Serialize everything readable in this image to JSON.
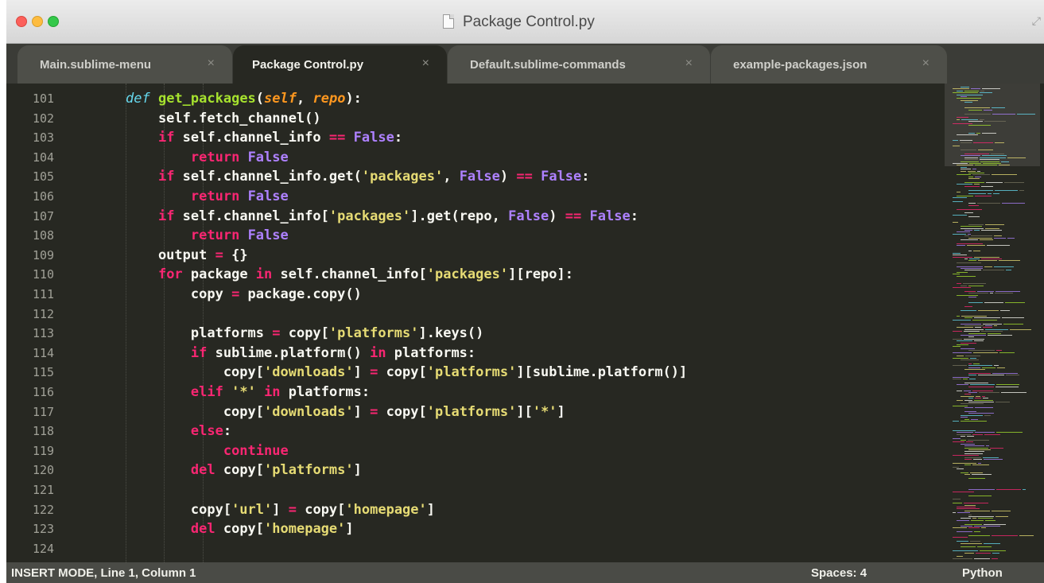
{
  "window": {
    "title": "Package Control.py"
  },
  "tabs": [
    {
      "label": "Main.sublime-menu",
      "close": "×",
      "active": false
    },
    {
      "label": "Package Control.py",
      "close": "×",
      "active": true
    },
    {
      "label": "Default.sublime-commands",
      "close": "×",
      "active": false
    },
    {
      "label": "example-packages.json",
      "close": "×",
      "active": false
    }
  ],
  "editor": {
    "line_numbers": [
      "101",
      "102",
      "103",
      "104",
      "105",
      "106",
      "107",
      "108",
      "109",
      "110",
      "111",
      "112",
      "113",
      "114",
      "115",
      "116",
      "117",
      "118",
      "119",
      "120",
      "121",
      "122",
      "123",
      "124"
    ],
    "lines": [
      "    def get_packages(self, repo):",
      "        self.fetch_channel()",
      "        if self.channel_info == False:",
      "            return False",
      "        if self.channel_info.get('packages', False) == False:",
      "            return False",
      "        if self.channel_info['packages'].get(repo, False) == False:",
      "            return False",
      "        output = {}",
      "        for package in self.channel_info['packages'][repo]:",
      "            copy = package.copy()",
      "",
      "            platforms = copy['platforms'].keys()",
      "            if sublime.platform() in platforms:",
      "                copy['downloads'] = copy['platforms'][sublime.platform()]",
      "            elif '*' in platforms:",
      "                copy['downloads'] = copy['platforms']['*']",
      "            else:",
      "                continue",
      "            del copy['platforms']",
      "",
      "            copy['url'] = copy['homepage']",
      "            del copy['homepage']",
      ""
    ],
    "syntax_colors": {
      "background": "#272822",
      "keyword": "#f92672",
      "storage": "#66d9ef",
      "function": "#a6e22e",
      "parameter": "#fd971f",
      "constant": "#ae81ff",
      "string": "#e6db74",
      "text": "#f8f8f2"
    }
  },
  "statusbar": {
    "mode": "INSERT MODE, Line 1, Column 1",
    "spaces": "Spaces: 4",
    "syntax": "Python"
  }
}
